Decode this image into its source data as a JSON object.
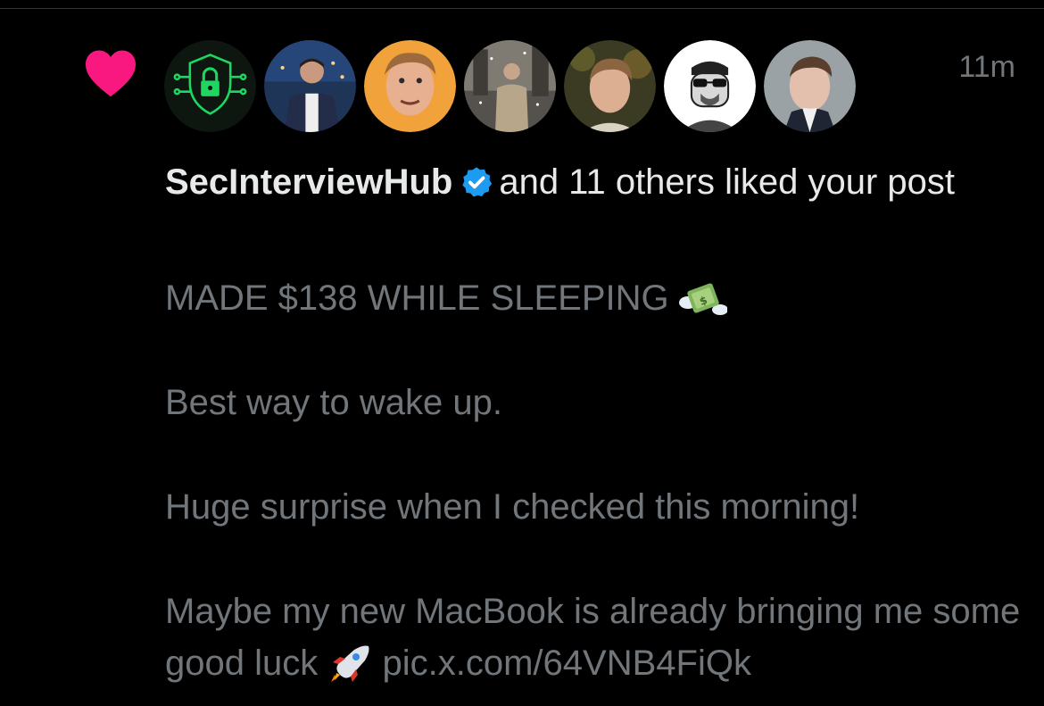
{
  "notification": {
    "timestamp": "11m",
    "liker_name": "SecInterviewHub",
    "liker_verified": true,
    "action_text": "and 11 others liked your post",
    "avatars": [
      {
        "name": "shield-lock-avatar"
      },
      {
        "name": "user-avatar-2"
      },
      {
        "name": "user-avatar-3"
      },
      {
        "name": "user-avatar-4"
      },
      {
        "name": "user-avatar-5"
      },
      {
        "name": "cartoon-sunglasses-avatar"
      },
      {
        "name": "user-avatar-7"
      }
    ]
  },
  "post": {
    "line1": "MADE $138 WHILE SLEEPING",
    "line2": "Best way to wake up.",
    "line3": "Huge surprise when I checked this morning!",
    "line4_part1": "Maybe my new MacBook is already bringing me some good luck",
    "link": "pic.x.com/64VNB4FiQk",
    "emoji_1": "money-with-wings-icon",
    "emoji_2": "rocket-icon"
  },
  "colors": {
    "background": "#000000",
    "primary_text": "#e7e9ea",
    "secondary_text": "#71767b",
    "heart": "#f91880",
    "verified": "#1d9bf0"
  }
}
